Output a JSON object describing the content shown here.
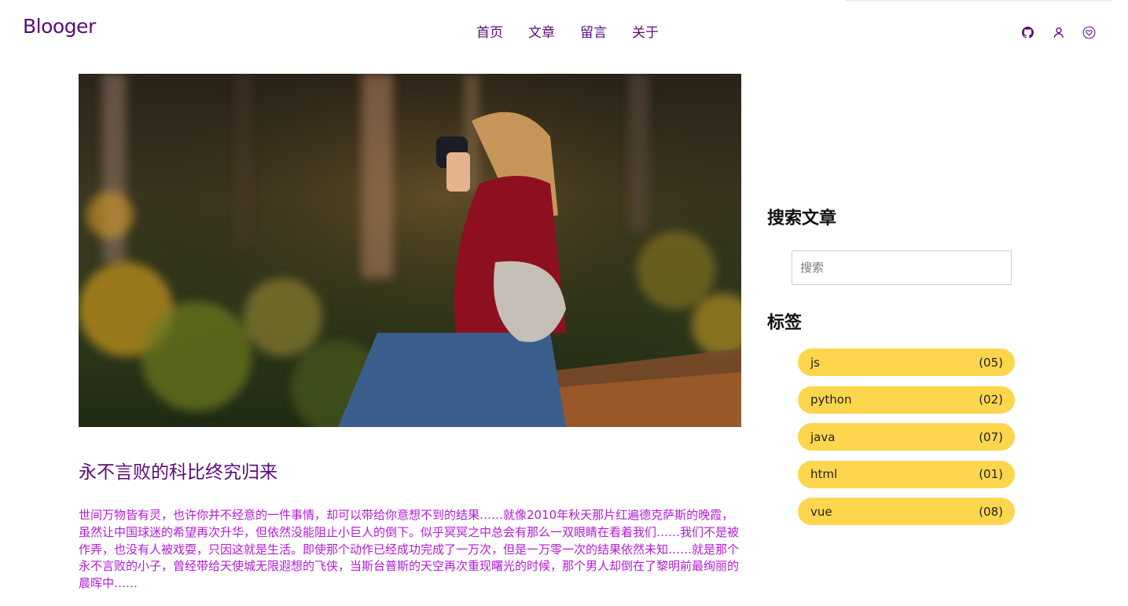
{
  "header": {
    "logo": "Blooger",
    "nav": [
      "首页",
      "文章",
      "留言",
      "关于"
    ],
    "icons": [
      "github-icon",
      "user-icon",
      "heart-icon"
    ]
  },
  "post": {
    "image": "photographer-in-forest",
    "title": "永不言败的科比终究归来",
    "excerpt": "世间万物皆有灵，也许你并不经意的一件事情，却可以带给你意想不到的结果……就像2010年秋天那片红遍德克萨斯的晚霞，虽然让中国球迷的希望再次升华，但依然没能阻止小巨人的倒下。似乎冥冥之中总会有那么一双眼睛在看着我们……我们不是被作弄，也没有人被戏耍，只因这就是生活。即使那个动作已经成功完成了一万次，但是一万零一次的结果依然未知……就是那个永不言败的小子，曾经带给天使城无限遐想的飞侠，当斯台普斯的天空再次重现曙光的时候，那个男人却倒在了黎明前最绚丽的晨晖中……"
  },
  "sidebar": {
    "search_heading": "搜索文章",
    "search_placeholder": "搜索",
    "tags_heading": "标签",
    "tags": [
      {
        "name": "js",
        "count": "(05)"
      },
      {
        "name": "python",
        "count": "(02)"
      },
      {
        "name": "java",
        "count": "(07)"
      },
      {
        "name": "html",
        "count": "(01)"
      },
      {
        "name": "vue",
        "count": "(08)"
      }
    ]
  },
  "colors": {
    "brand": "#5b0a78",
    "excerpt": "#b31bd6",
    "tag_bg": "#fed64d"
  }
}
